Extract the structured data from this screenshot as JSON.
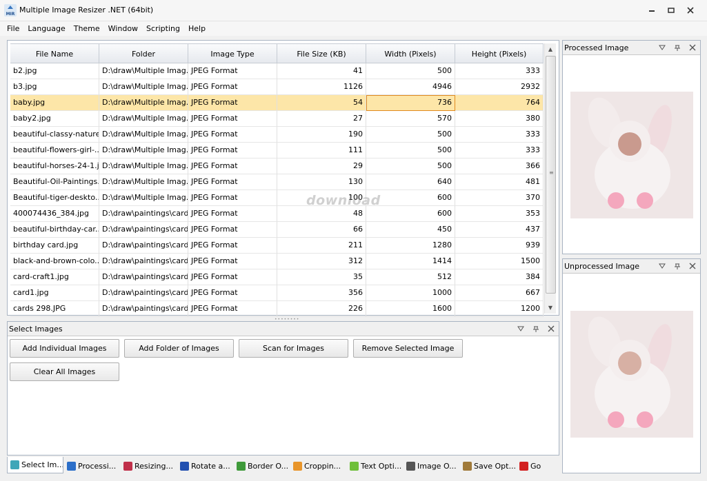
{
  "window": {
    "title": "Multiple Image Resizer .NET (64bit)",
    "icon_label": "MIR"
  },
  "menu": [
    "File",
    "Language",
    "Theme",
    "Window",
    "Scripting",
    "Help"
  ],
  "table": {
    "columns": [
      "File Name",
      "Folder",
      "Image Type",
      "File Size (KB)",
      "Width (Pixels)",
      "Height (Pixels)"
    ],
    "selected_row": 2,
    "rows": [
      [
        "b2.jpg",
        "D:\\draw\\Multiple Imag...",
        "JPEG Format",
        "41",
        "500",
        "333"
      ],
      [
        "b3.jpg",
        "D:\\draw\\Multiple Imag...",
        "JPEG Format",
        "1126",
        "4946",
        "2932"
      ],
      [
        "baby.jpg",
        "D:\\draw\\Multiple Imag...",
        "JPEG Format",
        "54",
        "736",
        "764"
      ],
      [
        "baby2.jpg",
        "D:\\draw\\Multiple Imag...",
        "JPEG Format",
        "27",
        "570",
        "380"
      ],
      [
        "beautiful-classy-nature...",
        "D:\\draw\\Multiple Imag...",
        "JPEG Format",
        "190",
        "500",
        "333"
      ],
      [
        "beautiful-flowers-girl-...",
        "D:\\draw\\Multiple Imag...",
        "JPEG Format",
        "111",
        "500",
        "333"
      ],
      [
        "beautiful-horses-24-1.j...",
        "D:\\draw\\Multiple Imag...",
        "JPEG Format",
        "29",
        "500",
        "366"
      ],
      [
        "Beautiful-Oil-Paintings...",
        "D:\\draw\\Multiple Imag...",
        "JPEG Format",
        "130",
        "640",
        "481"
      ],
      [
        "Beautiful-tiger-deskto...",
        "D:\\draw\\Multiple Imag...",
        "JPEG Format",
        "100",
        "600",
        "370"
      ],
      [
        "400074436_384.jpg",
        "D:\\draw\\paintings\\cards",
        "JPEG Format",
        "48",
        "600",
        "353"
      ],
      [
        "beautiful-birthday-car...",
        "D:\\draw\\paintings\\cards",
        "JPEG Format",
        "66",
        "450",
        "437"
      ],
      [
        "birthday card.jpg",
        "D:\\draw\\paintings\\cards",
        "JPEG Format",
        "211",
        "1280",
        "939"
      ],
      [
        "black-and-brown-colo...",
        "D:\\draw\\paintings\\cards",
        "JPEG Format",
        "312",
        "1414",
        "1500"
      ],
      [
        "card-craft1.jpg",
        "D:\\draw\\paintings\\cards",
        "JPEG Format",
        "35",
        "512",
        "384"
      ],
      [
        "card1.jpg",
        "D:\\draw\\paintings\\cards",
        "JPEG Format",
        "356",
        "1000",
        "667"
      ],
      [
        "cards 298.JPG",
        "D:\\draw\\paintings\\cards",
        "JPEG Format",
        "226",
        "1600",
        "1200"
      ]
    ]
  },
  "watermark": "download",
  "select_panel": {
    "title": "Select Images",
    "buttons": {
      "add_individual": "Add Individual Images",
      "add_folder": "Add Folder of Images",
      "scan": "Scan for Images",
      "remove_selected": "Remove Selected Image",
      "clear_all": "Clear All Images"
    }
  },
  "tabs": [
    {
      "label": "Select Im...",
      "color": "#3fa6b8",
      "active": true
    },
    {
      "label": "Processi...",
      "color": "#2c6fc9",
      "active": false
    },
    {
      "label": "Resizing...",
      "color": "#c0304a",
      "active": false
    },
    {
      "label": "Rotate a...",
      "color": "#2250b0",
      "active": false
    },
    {
      "label": "Border O...",
      "color": "#3f9a3a",
      "active": false
    },
    {
      "label": "Croppin...",
      "color": "#e8952a",
      "active": false
    },
    {
      "label": "Text Opti...",
      "color": "#6fbf3a",
      "active": false
    },
    {
      "label": "Image O...",
      "color": "#555555",
      "active": false
    },
    {
      "label": "Save Opt...",
      "color": "#a07a3a",
      "active": false
    },
    {
      "label": "Go",
      "color": "#d22020",
      "active": false
    }
  ],
  "right_panels": {
    "processed_title": "Processed Image",
    "unprocessed_title": "Unprocessed Image"
  },
  "colors": {
    "selection": "#fde6a8",
    "focus_cell": "#e08a1e"
  }
}
